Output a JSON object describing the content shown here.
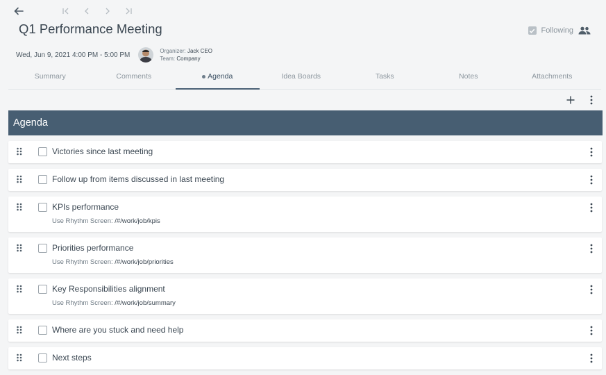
{
  "header": {
    "title": "Q1 Performance Meeting",
    "following_label": "Following",
    "datetime": "Wed, Jun 9, 2021 4:00 PM - 5:00 PM",
    "organizer_label": "Organizer:",
    "organizer_name": "Jack CEO",
    "team_label": "Team:",
    "team_name": "Company"
  },
  "nav": {
    "back_icon": "arrow-left-icon",
    "first_icon": "first-page-icon",
    "prev_icon": "chevron-left-icon",
    "next_icon": "chevron-right-icon",
    "last_icon": "last-page-icon"
  },
  "tabs": [
    {
      "label": "Summary"
    },
    {
      "label": "Comments"
    },
    {
      "label": "Agenda",
      "active": true
    },
    {
      "label": "Idea Boards"
    },
    {
      "label": "Tasks"
    },
    {
      "label": "Notes"
    },
    {
      "label": "Attachments"
    }
  ],
  "section": {
    "title": "Agenda"
  },
  "agenda": {
    "items": [
      {
        "title": "Victories since last meeting"
      },
      {
        "title": "Follow up from items discussed in last meeting"
      },
      {
        "title": "KPIs performance",
        "sub_label": "Use Rhythm Screen:",
        "sub_path": "/#/work/job/kpis"
      },
      {
        "title": "Priorities performance",
        "sub_label": "Use Rhythm Screen:",
        "sub_path": "/#/work/job/priorities"
      },
      {
        "title": "Key Responsibilities alignment",
        "sub_label": "Use Rhythm Screen:",
        "sub_path": "/#/work/job/summary"
      },
      {
        "title": "Where are you stuck and need help"
      },
      {
        "title": "Next steps"
      }
    ]
  },
  "colors": {
    "header_bar": "#475e72",
    "active_tab": "#4a6075",
    "background": "#f4f5f6"
  }
}
